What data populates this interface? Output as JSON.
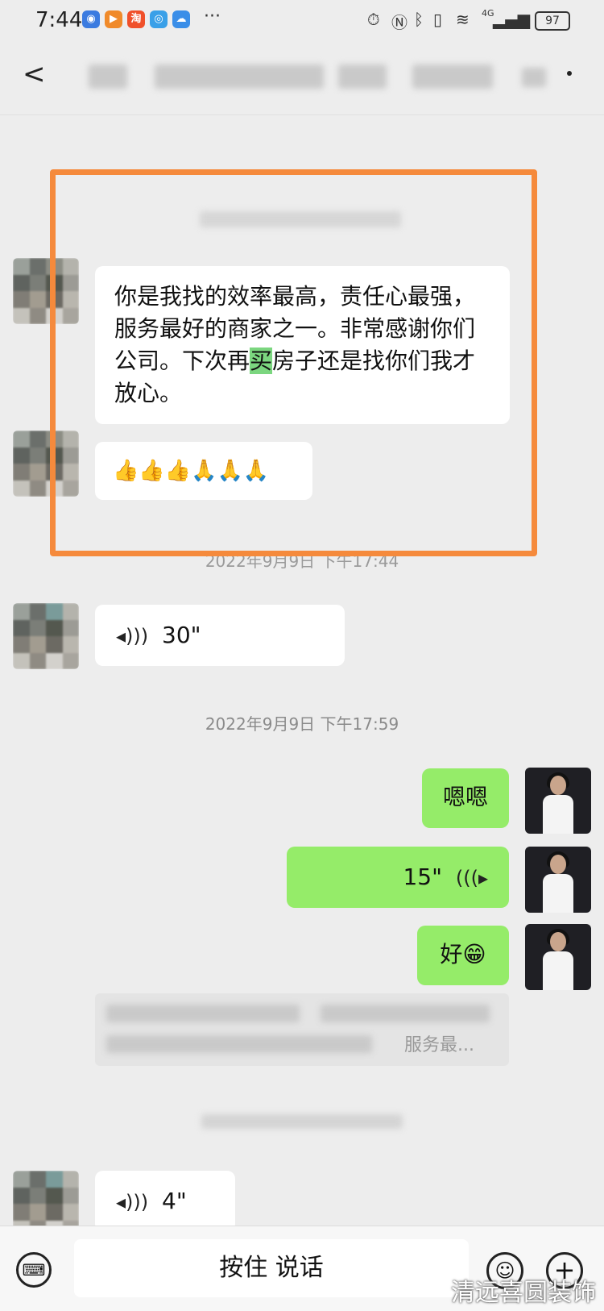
{
  "status_bar": {
    "time": "7:44",
    "apps": [
      {
        "name": "app-icon-1",
        "glyph": "◉",
        "color": "#3b7be0"
      },
      {
        "name": "app-icon-2",
        "glyph": "▶",
        "color": "#f08a2a"
      },
      {
        "name": "taobao-icon",
        "glyph": "淘",
        "color": "#f0502a"
      },
      {
        "name": "app-icon-4",
        "glyph": "◎",
        "color": "#3aa0e8"
      },
      {
        "name": "cloud-icon",
        "glyph": "☁",
        "color": "#3a8ee8"
      }
    ],
    "dots": "···",
    "network_type": "4G",
    "battery": "97"
  },
  "header": {
    "back_glyph": "<"
  },
  "messages": {
    "incoming_text_1": {
      "before": "你是我找的效率最高，责任心最强，服务最好的商家之一。非常感谢你们公司。下次再",
      "highlight": "买",
      "after": "房子还是找你们我才放心。"
    },
    "incoming_emoji_2": "👍👍👍🙏🙏🙏",
    "timestamp_1": "2022年9月9日 下午17:44",
    "incoming_voice_1": "30\"",
    "timestamp_2": "2022年9月9日 下午17:59",
    "outgoing_1": "嗯嗯",
    "outgoing_voice": "15\"",
    "outgoing_2": "好😁",
    "incoming_quote_tail": "服务最...",
    "incoming_voice_2": "4\""
  },
  "input_bar": {
    "talk_label": "按住 说话"
  },
  "watermark": "清远喜圆装饰",
  "colors": {
    "background": "#ededed",
    "outgoing_bubble": "#95ec69",
    "incoming_bubble": "#ffffff",
    "highlight_box": "#f58a3c"
  }
}
